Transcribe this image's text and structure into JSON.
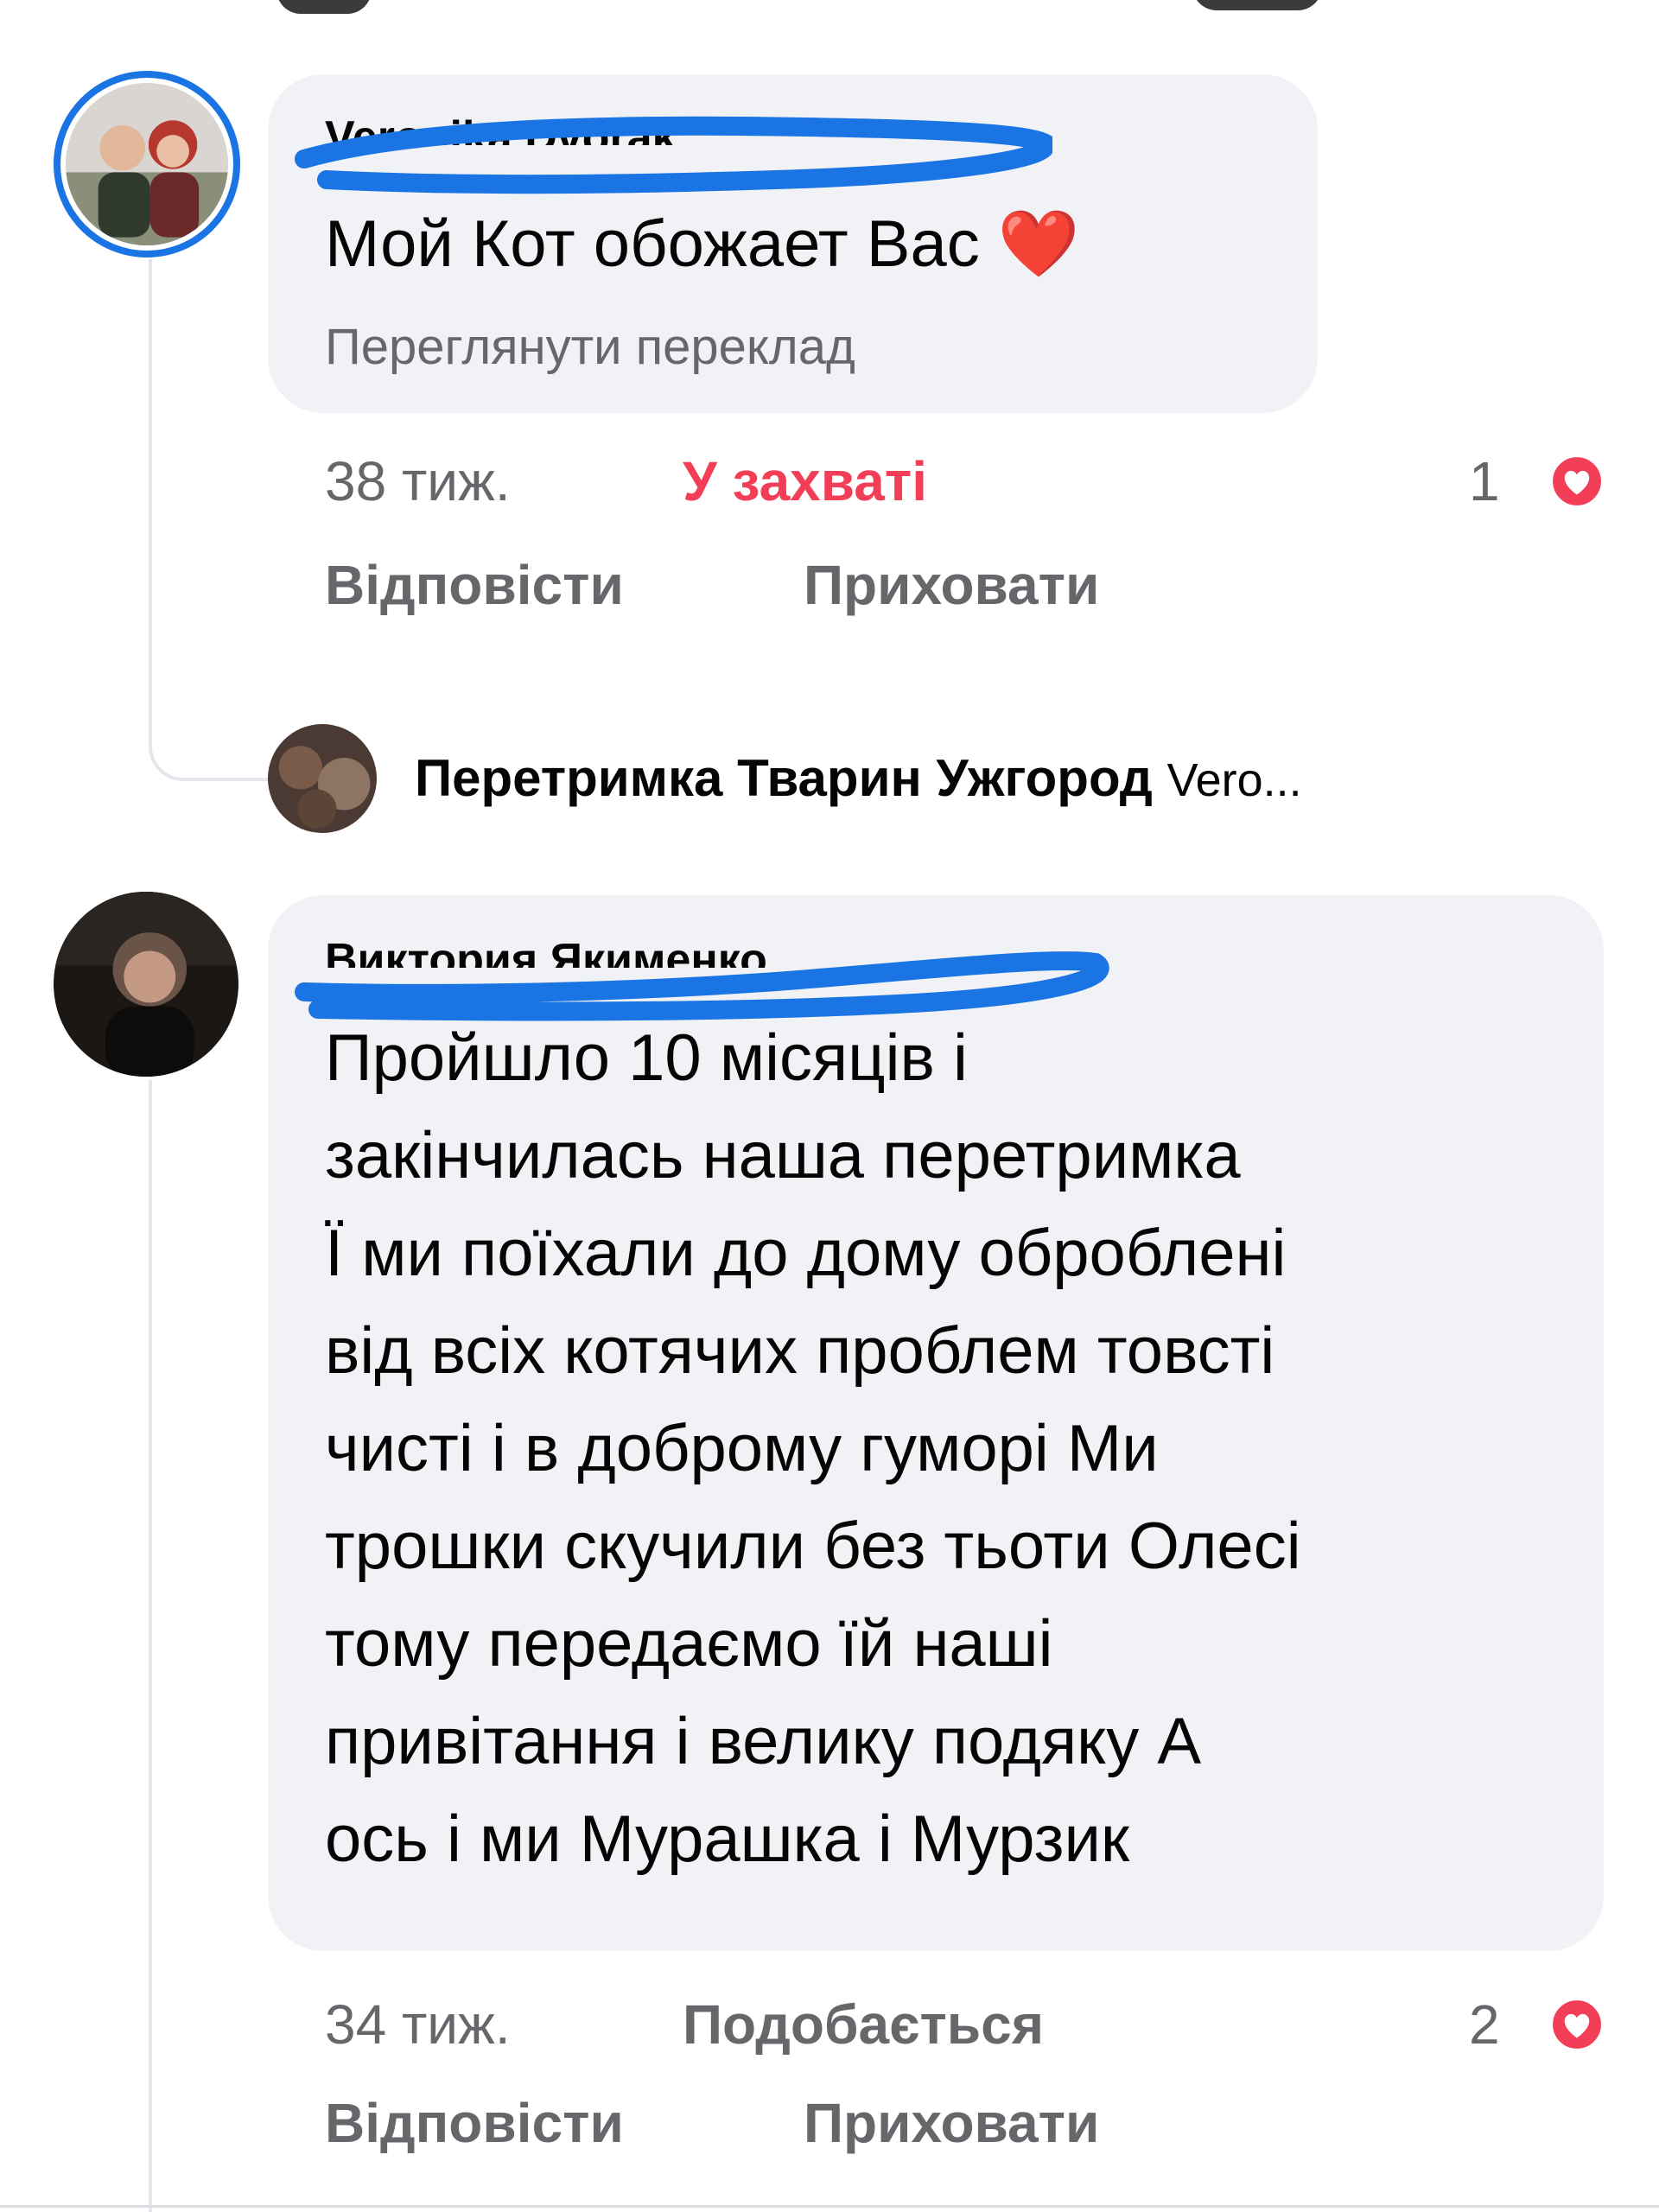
{
  "comments": [
    {
      "author": "Veronika Dvorak",
      "text": "Мой Кот обожает Вас ❤️",
      "translate_link": "Переглянути переклад",
      "time": "38 тиж.",
      "reaction_label": "У захваті",
      "reaction_count": "1",
      "reply_label": "Відповісти",
      "hide_label": "Приховати",
      "reply_summary": {
        "author": "Перетримка Тварин Ужгород",
        "snippet": "Vero..."
      }
    },
    {
      "author": "Виктория Якименко",
      "text_lines": [
        "Пройшло 10 місяців і",
        "закінчилась наша перетримка",
        "Ї ми поїхали до дому оброблені",
        "від всіх котячих проблем товсті",
        "чисті і в доброму гуморі Ми",
        "трошки скучили без тьоти Олесі",
        "тому передаємо їй наші",
        "привітання і велику подяку А",
        "ось і ми Мурашка і Мурзик"
      ],
      "time": "34 тиж.",
      "like_label": "Подобається",
      "reaction_count": "2",
      "reply_label": "Відповісти",
      "hide_label": "Приховати"
    }
  ],
  "icons": {
    "reaction": "heart-reaction-icon",
    "emoji": "red-heart-emoji"
  },
  "colors": {
    "bubble": "#f0f2f5",
    "secondary_text": "#65676b",
    "love_reaction": "#f33e58",
    "scribble": "#1b74e4",
    "avatar_ring": "#1b74e4"
  }
}
